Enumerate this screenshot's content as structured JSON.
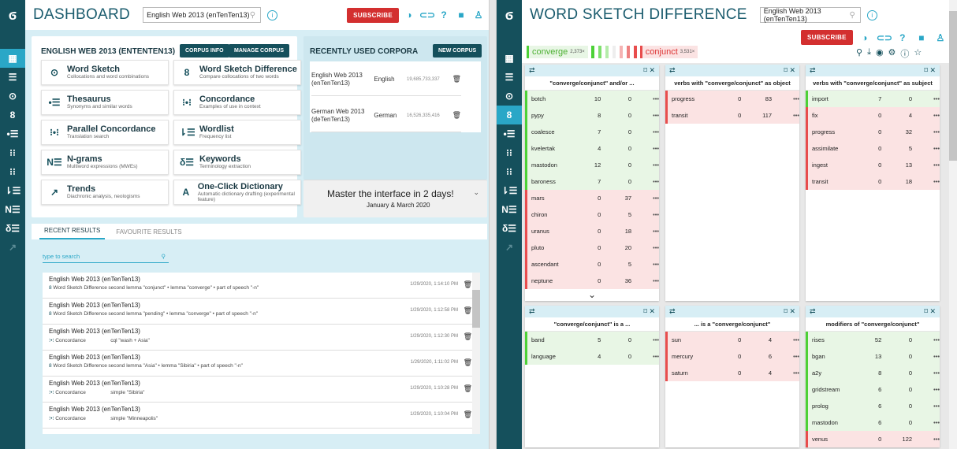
{
  "left": {
    "title": "DASHBOARD",
    "corpus_select": "English Web 2013 (enTenTen13)",
    "subscribe": "SUBSCRIBE",
    "corpus_card": {
      "title": "ENGLISH WEB 2013 (ENTENTEN13)",
      "info_btn": "CORPUS INFO",
      "manage_btn": "MANAGE CORPUS"
    },
    "tools": [
      {
        "name": "Word Sketch",
        "desc": "Collocations and word combinations",
        "icon": "⊙"
      },
      {
        "name": "Word Sketch Difference",
        "desc": "Compare collocations of two words",
        "icon": "8"
      },
      {
        "name": "Thesaurus",
        "desc": "Synonyms and similar words",
        "icon": "•☰"
      },
      {
        "name": "Concordance",
        "desc": "Examples of use in context",
        "icon": "⁝•⁝"
      },
      {
        "name": "Parallel Concordance",
        "desc": "Translation search",
        "icon": "⁝•⁝"
      },
      {
        "name": "Wordlist",
        "desc": "Frequency list",
        "icon": "⇂☰"
      },
      {
        "name": "N-grams",
        "desc": "Multiword expressions (MWEs)",
        "icon": "N☰"
      },
      {
        "name": "Keywords",
        "desc": "Terminology extraction",
        "icon": "δ☰"
      },
      {
        "name": "Trends",
        "desc": "Diachronic analysis, neologisms",
        "icon": "↗"
      },
      {
        "name": "One-Click Dictionary",
        "desc": "Automatic dictionary drafting (experimental feature)",
        "icon": "A"
      }
    ],
    "recent_corpora": {
      "title": "RECENTLY USED CORPORA",
      "new_btn": "NEW CORPUS",
      "items": [
        {
          "name": "English Web 2013 (enTenTen13)",
          "lang": "English",
          "size": "19,685,733,337"
        },
        {
          "name": "German Web 2013 (deTenTen13)",
          "lang": "German",
          "size": "16,526,335,416"
        }
      ]
    },
    "promo": {
      "title": "Master the interface in 2 days!",
      "date": "January & March 2020"
    },
    "tabs": [
      "RECENT RESULTS",
      "FAVOURITE RESULTS"
    ],
    "search_placeholder": "type to search",
    "results": [
      {
        "corpus": "English Web 2013 (enTenTen13)",
        "tool": "Word Sketch Difference",
        "query": "second lemma \"conjunct\" • lemma \"converge\" • part of speech \"-n\"",
        "date": "1/29/2020, 1:14:10 PM"
      },
      {
        "corpus": "English Web 2013 (enTenTen13)",
        "tool": "Word Sketch Difference",
        "query": "second lemma \"pending\" • lemma \"converge\" • part of speech \"-n\"",
        "date": "1/29/2020, 1:12:58 PM"
      },
      {
        "corpus": "English Web 2013 (enTenTen13)",
        "tool": "Concordance",
        "query": "cql \"wash + Asia\"",
        "date": "1/29/2020, 1:12:30 PM"
      },
      {
        "corpus": "English Web 2013 (enTenTen13)",
        "tool": "Word Sketch Difference",
        "query": "second lemma \"Asia\" • lemma \"Sibiria\" • part of speech \"-n\"",
        "date": "1/29/2020, 1:11:02 PM"
      },
      {
        "corpus": "English Web 2013 (enTenTen13)",
        "tool": "Concordance",
        "query": "simple \"Sibiria\"",
        "date": "1/29/2020, 1:10:28 PM"
      },
      {
        "corpus": "English Web 2013 (enTenTen13)",
        "tool": "Concordance",
        "query": "simple \"Minneapolis\"",
        "date": "1/29/2020, 1:10:04 PM"
      }
    ]
  },
  "right": {
    "title": "WORD SKETCH DIFFERENCE",
    "corpus_select": "English Web 2013 (enTenTen13)",
    "subscribe": "SUBSCRIBE",
    "lemma1": "converge",
    "lemma1_freq": "2,373×",
    "lemma2": "conjunct",
    "lemma2_freq": "3,531×",
    "panels": [
      {
        "title": "\"converge/conjunct\" and/or ...",
        "rows": [
          [
            "botch",
            "10",
            "0",
            "g"
          ],
          [
            "pypy",
            "8",
            "0",
            "g"
          ],
          [
            "coalesce",
            "7",
            "0",
            "g"
          ],
          [
            "kvelertak",
            "4",
            "0",
            "g"
          ],
          [
            "mastodon",
            "12",
            "0",
            "g"
          ],
          [
            "baroness",
            "7",
            "0",
            "g"
          ],
          [
            "mars",
            "0",
            "37",
            "r"
          ],
          [
            "chiron",
            "0",
            "5",
            "r"
          ],
          [
            "uranus",
            "0",
            "18",
            "r"
          ],
          [
            "pluto",
            "0",
            "20",
            "r"
          ],
          [
            "ascendant",
            "0",
            "5",
            "r"
          ],
          [
            "neptune",
            "0",
            "36",
            "r"
          ]
        ]
      },
      {
        "title": "verbs with \"converge/conjunct\" as object",
        "rows": [
          [
            "progress",
            "0",
            "83",
            "r"
          ],
          [
            "transit",
            "0",
            "117",
            "r"
          ]
        ]
      },
      {
        "title": "verbs with \"converge/conjunct\" as subject",
        "rows": [
          [
            "import",
            "7",
            "0",
            "g"
          ],
          [
            "fix",
            "0",
            "4",
            "r"
          ],
          [
            "progress",
            "0",
            "32",
            "r"
          ],
          [
            "assimilate",
            "0",
            "5",
            "r"
          ],
          [
            "ingest",
            "0",
            "13",
            "r"
          ],
          [
            "transit",
            "0",
            "18",
            "r"
          ]
        ]
      },
      {
        "title": "\"converge/conjunct\" is a ...",
        "rows": [
          [
            "band",
            "5",
            "0",
            "g"
          ],
          [
            "language",
            "4",
            "0",
            "g"
          ]
        ]
      },
      {
        "title": "... is a \"converge/conjunct\"",
        "rows": [
          [
            "sun",
            "0",
            "4",
            "r"
          ],
          [
            "mercury",
            "0",
            "6",
            "r"
          ],
          [
            "saturn",
            "0",
            "4",
            "r"
          ]
        ]
      },
      {
        "title": "modifiers of \"converge/conjunct\"",
        "rows": [
          [
            "rises",
            "52",
            "0",
            "g"
          ],
          [
            "bgan",
            "13",
            "0",
            "g"
          ],
          [
            "a2y",
            "8",
            "0",
            "g"
          ],
          [
            "gridstream",
            "6",
            "0",
            "g"
          ],
          [
            "prolog",
            "6",
            "0",
            "g"
          ],
          [
            "mastodon",
            "6",
            "0",
            "g"
          ],
          [
            "venus",
            "0",
            "122",
            "r"
          ]
        ]
      }
    ]
  }
}
